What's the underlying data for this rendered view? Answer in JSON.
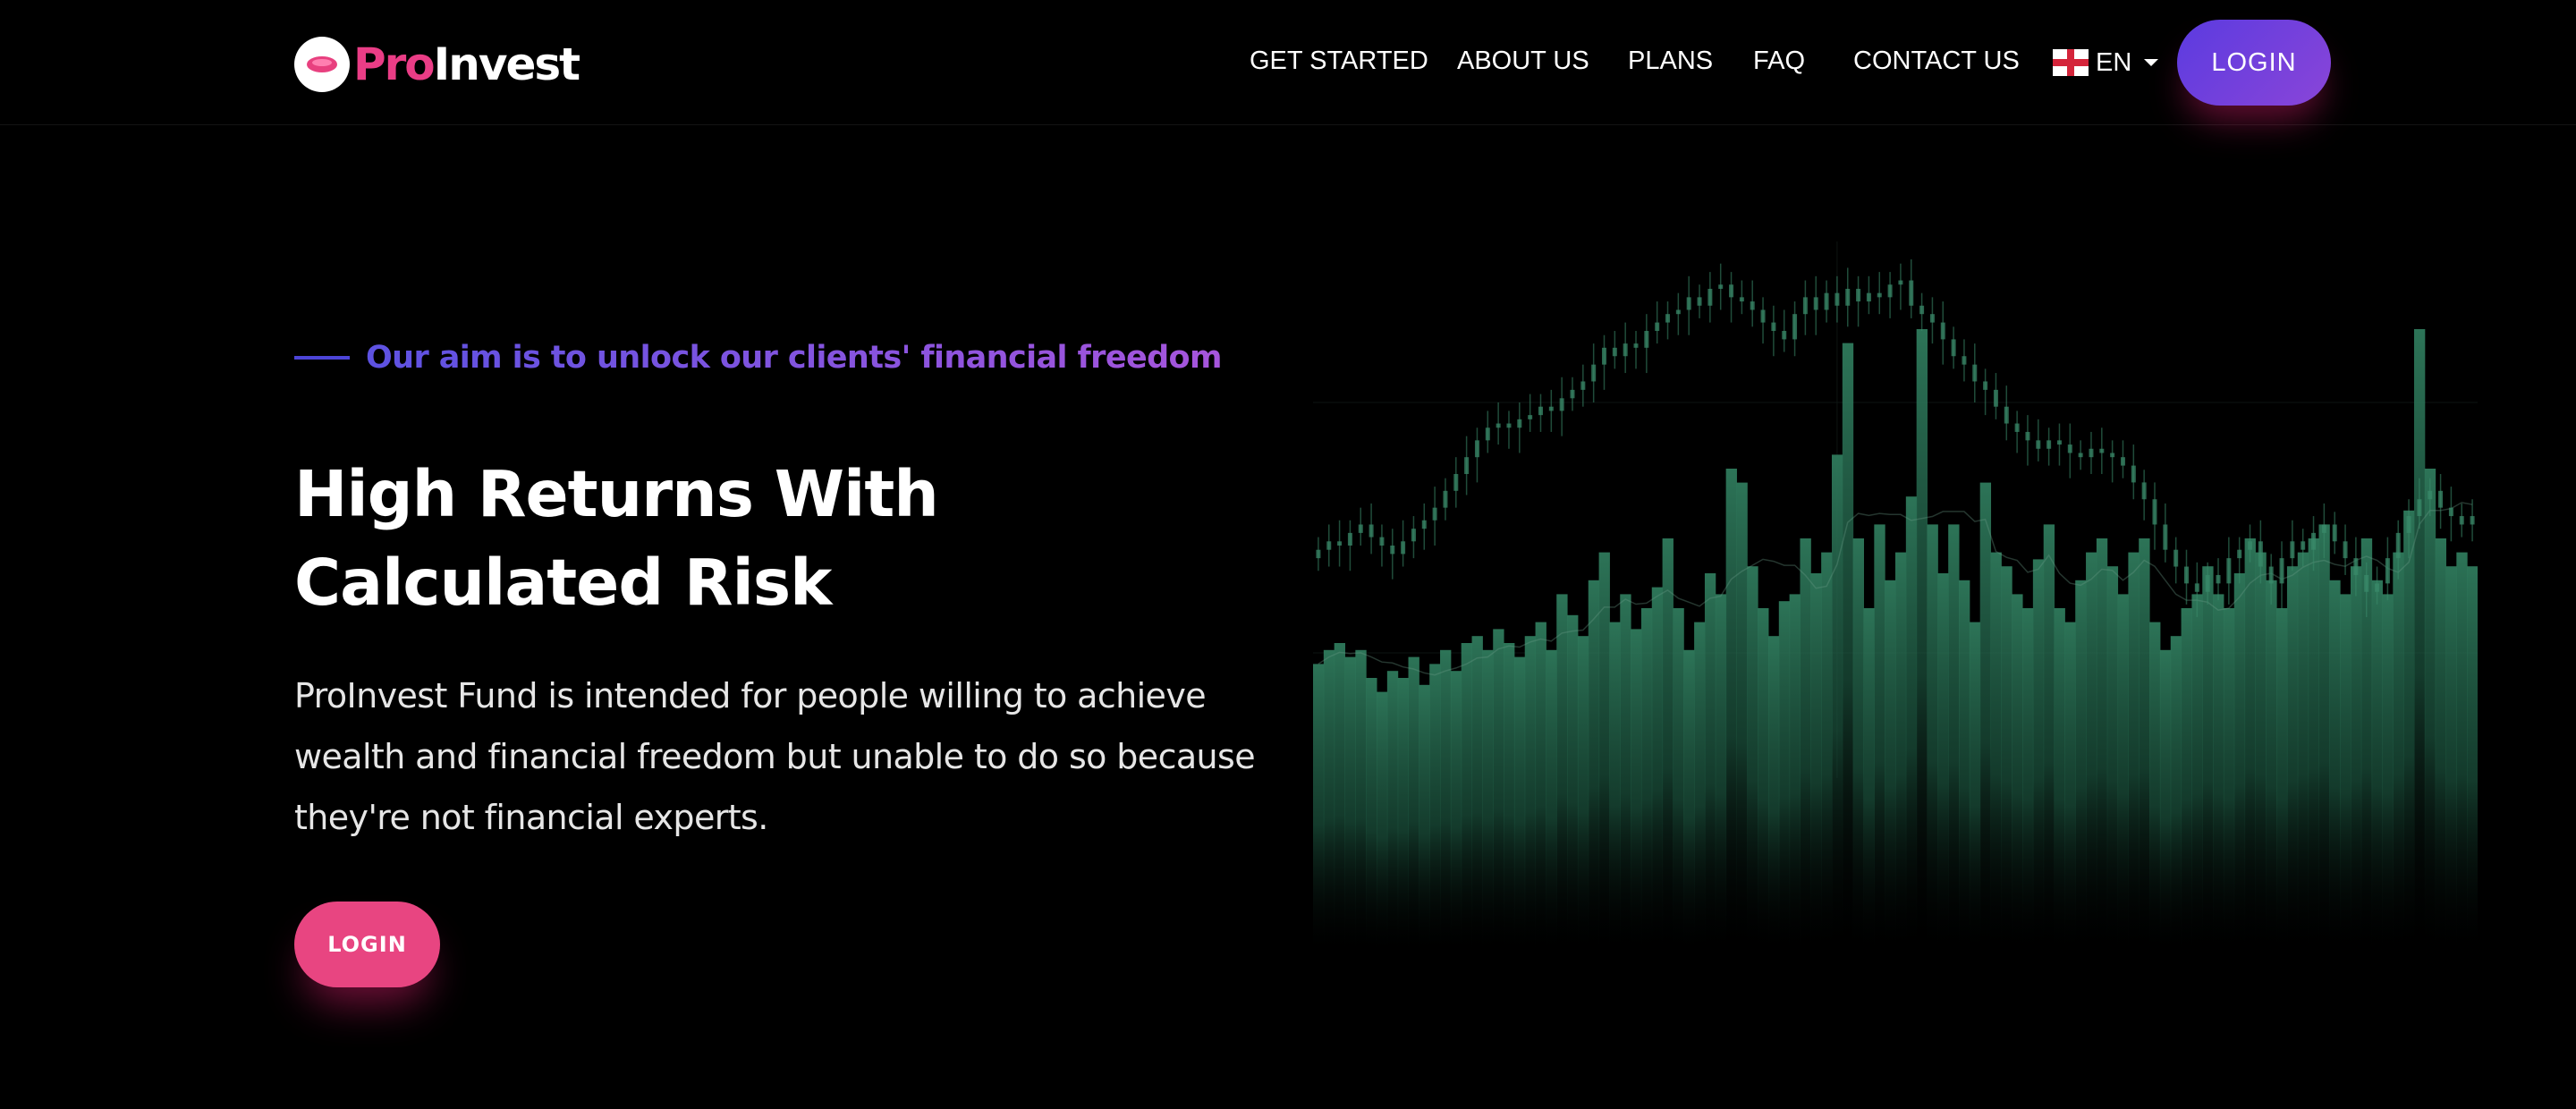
{
  "brand": {
    "name_part1": "Pro",
    "name_part2": "Invest",
    "logo_icon": "coin-logo-icon"
  },
  "nav": {
    "links": [
      "GET STARTED",
      "ABOUT US",
      "PLANS",
      "FAQ",
      "CONTACT US"
    ],
    "language": {
      "label": "EN",
      "flag_icon": "england-flag-icon"
    },
    "login_label": "LOGIN"
  },
  "hero": {
    "tagline": "Our aim is to unlock our clients' financial freedom",
    "headline": "High Returns With Calculated Risk",
    "description": "ProInvest Fund is intended for people willing to achieve wealth and financial freedom but unable to do so because they're not financial experts.",
    "login_label": "LOGIN"
  },
  "colors": {
    "background": "#000000",
    "brand_pink": "#ea3d86",
    "button_purple": "#6a40dc",
    "tagline_gradient_start": "#5d52e2",
    "tagline_gradient_end": "#a655dc",
    "chart_green": "#3a8a6a"
  },
  "chart_data": {
    "type": "bar",
    "title": "",
    "candles_close": [
      56,
      58,
      57,
      60,
      62,
      59,
      57,
      55,
      58,
      61,
      63,
      66,
      70,
      74,
      78,
      82,
      85,
      86,
      85,
      87,
      88,
      90,
      89,
      92,
      94,
      96,
      100,
      104,
      102,
      105,
      104,
      108,
      110,
      112,
      113,
      116,
      114,
      118,
      119,
      116,
      115,
      113,
      110,
      108,
      106,
      112,
      116,
      113,
      117,
      114,
      118,
      115,
      117,
      116,
      119,
      120,
      114,
      112,
      110,
      106,
      102,
      100,
      96,
      94,
      90,
      86,
      84,
      82,
      80,
      82,
      81,
      79,
      78,
      80,
      79,
      78,
      76,
      72,
      68,
      62,
      56,
      52,
      48,
      46,
      50,
      48,
      54,
      56,
      58,
      52,
      48,
      54,
      58,
      56,
      60,
      62,
      58,
      54,
      50,
      46,
      48,
      54,
      60,
      64,
      68,
      70,
      66,
      64,
      62,
      64
    ],
    "volume": [
      42,
      44,
      45,
      43,
      44,
      40,
      38,
      41,
      40,
      43,
      39,
      42,
      44,
      41,
      45,
      46,
      44,
      47,
      45,
      43,
      46,
      48,
      44,
      52,
      49,
      46,
      54,
      58,
      48,
      52,
      47,
      50,
      53,
      60,
      50,
      44,
      48,
      55,
      52,
      70,
      68,
      56,
      50,
      46,
      51,
      52,
      60,
      55,
      58,
      72,
      88,
      60,
      50,
      62,
      54,
      58,
      66,
      90,
      62,
      55,
      62,
      54,
      48,
      68,
      58,
      56,
      52,
      50,
      57,
      62,
      50,
      48,
      54,
      58,
      60,
      56,
      52,
      58,
      60,
      48,
      44,
      46,
      50,
      52,
      56,
      52,
      50,
      55,
      60,
      58,
      54,
      50,
      56,
      58,
      60,
      62,
      54,
      52,
      56,
      60,
      54,
      52,
      58,
      64,
      90,
      70,
      60,
      56,
      58,
      56
    ]
  }
}
